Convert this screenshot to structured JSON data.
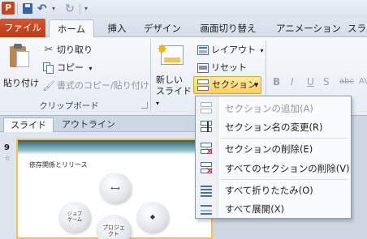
{
  "app": {
    "icon_letter": "P"
  },
  "tabs": [
    "ファイル",
    "ホーム",
    "挿入",
    "デザイン",
    "画面切り替え",
    "アニメーション",
    "スライ"
  ],
  "clipboard": {
    "paste": "貼り付け",
    "cut": "切り取り",
    "copy": "コピー",
    "copy_dd": "▾",
    "format_painter": "書式のコピー/貼り付け",
    "group_label": "クリップボード"
  },
  "slides_group": {
    "new_slide_line1": "新しい",
    "new_slide_line2": "スライド",
    "new_slide_dd": "▾",
    "layout": "レイアウト",
    "layout_dd": "▾",
    "reset": "リセット",
    "section": "セクション",
    "section_dd": "▼"
  },
  "font_buttons": [
    "B",
    "I",
    "U",
    "S",
    "abc",
    "AV"
  ],
  "pane": {
    "tab_slides": "スライド",
    "tab_outline": "アウトライン",
    "slide_number": "9",
    "slide_star": "☆"
  },
  "thumbnail": {
    "title": "依存関係とリリース",
    "bubble_small_text": "ジョブ\nゲーム",
    "bubble_main_text": "プロジェ\nクト"
  },
  "section_menu": [
    {
      "label": "セクションの追加(A)",
      "enabled": false
    },
    {
      "label": "セクション名の変更(R)",
      "enabled": true
    },
    {
      "label": "セクションの削除(E)",
      "enabled": true
    },
    {
      "label": "すべてのセクションの削除(V)",
      "enabled": true
    },
    {
      "label": "すべて折りたたみ(O)",
      "enabled": true
    },
    {
      "label": "すべて展開(X)",
      "enabled": true
    }
  ]
}
